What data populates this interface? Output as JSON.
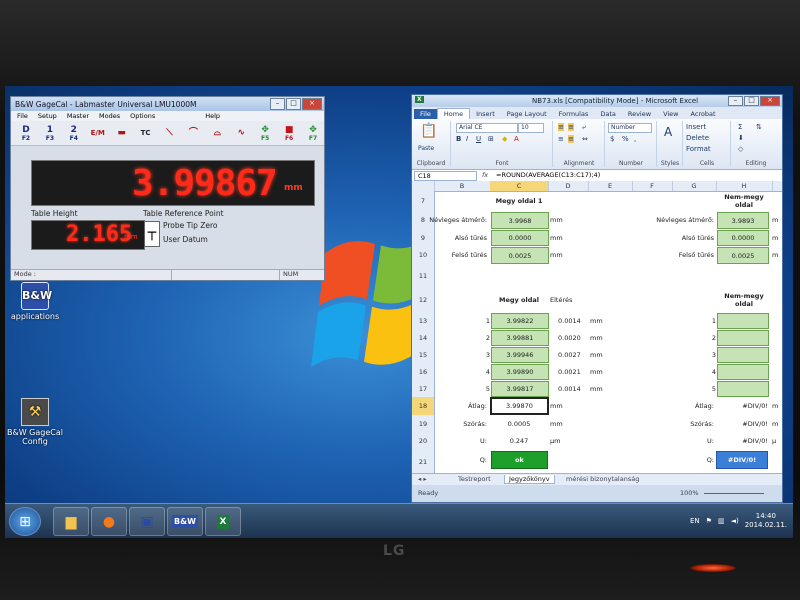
{
  "monitor": {
    "brand": "LG"
  },
  "desktop": {
    "icons": [
      {
        "label": "applications",
        "icon": "app-icon"
      },
      {
        "label": "B&W GageCal Config",
        "icon": "gagecal-config-icon"
      }
    ]
  },
  "taskbar": {
    "start": "windows-start-orb",
    "pinned": [
      "windows-explorer",
      "firefox",
      "save-floppy",
      "gagecal",
      "excel"
    ],
    "tray": {
      "lang": "EN",
      "time": "14:40",
      "date": "2014.02.11."
    }
  },
  "gagecal": {
    "title": "B&W GageCal - Labmaster Universal LMU1000M",
    "menu": [
      "File",
      "Setup",
      "Master",
      "Modes",
      "Options",
      "Help"
    ],
    "tools": [
      {
        "label": "F2",
        "sym": "D"
      },
      {
        "label": "F3",
        "sym": "1"
      },
      {
        "label": "F4",
        "sym": "2"
      },
      {
        "label": "",
        "sym": "E/M"
      },
      {
        "label": "",
        "sym": "▬"
      },
      {
        "label": "",
        "sym": "TC"
      },
      {
        "label": "",
        "sym": "⟍"
      },
      {
        "label": "",
        "sym": "⌒"
      },
      {
        "label": "",
        "sym": "⌓"
      },
      {
        "label": "",
        "sym": "∿"
      },
      {
        "label": "F5",
        "sym": "✥"
      },
      {
        "label": "F6",
        "sym": "■"
      },
      {
        "label": "F7",
        "sym": "✥"
      }
    ],
    "main_value": "3.99867",
    "main_unit": "mm",
    "table_height_label": "Table Height",
    "table_height_value": "2.165",
    "table_height_unit": "mm",
    "table_ref_label": "Table Reference Point",
    "option1": "Probe Tip Zero",
    "option2": "User Datum",
    "status_mode": "Mode :",
    "status_num": "NUM"
  },
  "excel": {
    "title": "NB73.xls [Compatibility Mode] - Microsoft Excel",
    "tabs": [
      "File",
      "Home",
      "Insert",
      "Page Layout",
      "Formulas",
      "Data",
      "Review",
      "View",
      "Acrobat"
    ],
    "ribbon": {
      "paste": "Paste",
      "clipboard": "Clipboard",
      "font_name": "Arial CE",
      "font_size": "10",
      "font": "Font",
      "alignment": "Alignment",
      "number_format": "Number",
      "number": "Number",
      "styles": "Styles",
      "insert": "Insert",
      "delete": "Delete",
      "format": "Format",
      "cells": "Cells",
      "editing": "Editing"
    },
    "name_box": "C18",
    "fx": "fx",
    "formula": "=ROUND(AVERAGE(C13:C17);4)",
    "columns": [
      "B",
      "C",
      "D",
      "E",
      "F",
      "G",
      "H"
    ],
    "rows": {
      "r7": {
        "num": "7",
        "c_title": "Megy oldal 1",
        "h_title": "Nem-megy oldal"
      },
      "r8": {
        "num": "8",
        "label": "Névleges átmérő:",
        "c": "3.9968",
        "unit": "mm",
        "g_label": "Névleges átmérő:",
        "h": "3.9893",
        "h_unit": "m"
      },
      "r9": {
        "num": "9",
        "label": "Alsó tűrés",
        "c": "0.0000",
        "unit": "mm",
        "g_label": "Alsó tűrés",
        "h": "0.0000",
        "h_unit": "m"
      },
      "r10": {
        "num": "10",
        "label": "Felső tűrés",
        "c": "0.0025",
        "unit": "mm",
        "g_label": "Felső tűrés",
        "h": "0.0025",
        "h_unit": "m"
      },
      "r11": {
        "num": "11"
      },
      "r12": {
        "num": "12",
        "c_title": "Megy oldal",
        "d_title": "Eltérés",
        "h_title": "Nem-megy oldal"
      },
      "r13": {
        "num": "13",
        "idx": "1",
        "c": "3.99822",
        "d": "0.0014",
        "unit": "mm",
        "g_idx": "1"
      },
      "r14": {
        "num": "14",
        "idx": "2",
        "c": "3.99881",
        "d": "0.0020",
        "unit": "mm",
        "g_idx": "2"
      },
      "r15": {
        "num": "15",
        "idx": "3",
        "c": "3.99946",
        "d": "0.0027",
        "unit": "mm",
        "g_idx": "3"
      },
      "r16": {
        "num": "16",
        "idx": "4",
        "c": "3.99890",
        "d": "0.0021",
        "unit": "mm",
        "g_idx": "4"
      },
      "r17": {
        "num": "17",
        "idx": "5",
        "c": "3.99817",
        "d": "0.0014",
        "unit": "mm",
        "g_idx": "5"
      },
      "r18": {
        "num": "18",
        "label": "Átlag:",
        "c": "3.99870",
        "unit": "mm",
        "g_label": "Átlag:",
        "h": "#DIV/0!",
        "h_unit": "m"
      },
      "r19": {
        "num": "19",
        "label": "Szórás:",
        "c": "0.0005",
        "unit": "mm",
        "g_label": "Szórás:",
        "h": "#DIV/0!",
        "h_unit": "m"
      },
      "r20": {
        "num": "20",
        "label": "U:",
        "c": "0.247",
        "unit": "µm",
        "g_label": "U:",
        "h": "#DIV/0!",
        "h_unit": "µ"
      },
      "r21": {
        "num": "21",
        "label": "Q:",
        "c": "ok",
        "g_label": "Q:",
        "h": "#DIV/0!"
      }
    },
    "sheets": [
      "Testreport",
      "Jegyzőkönyv",
      "mérési bizonytalanság"
    ],
    "status": "Ready",
    "zoom": "100%"
  },
  "colors": {
    "value_red": "#ff2a1a",
    "ok_green": "#1e9e2a",
    "error_blue": "#3c7fd9",
    "cell_green": "#c5e3b4"
  }
}
